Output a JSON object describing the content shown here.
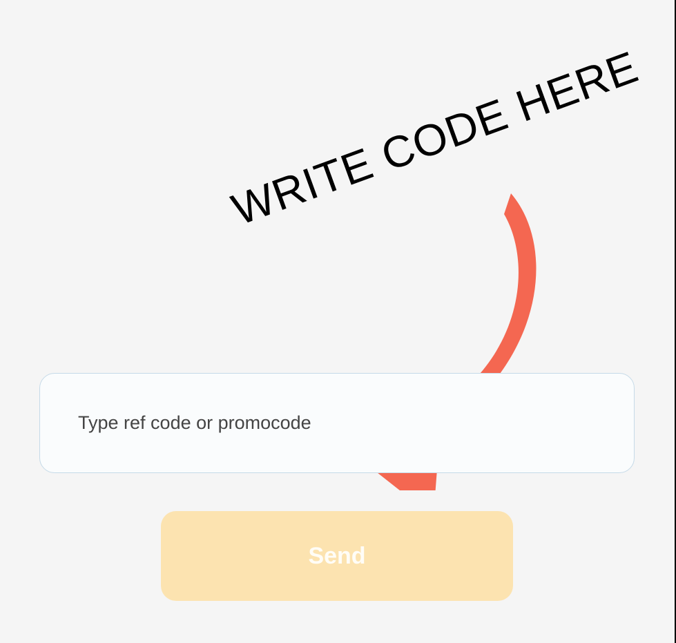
{
  "annotation": {
    "text": "WRITE CODE HERE"
  },
  "form": {
    "input": {
      "placeholder": "Type ref code or promocode",
      "value": ""
    },
    "button": {
      "label": "Send"
    }
  },
  "colors": {
    "arrow": "#f46751",
    "button_bg": "#fce3b0",
    "input_border": "#c5dae8"
  }
}
